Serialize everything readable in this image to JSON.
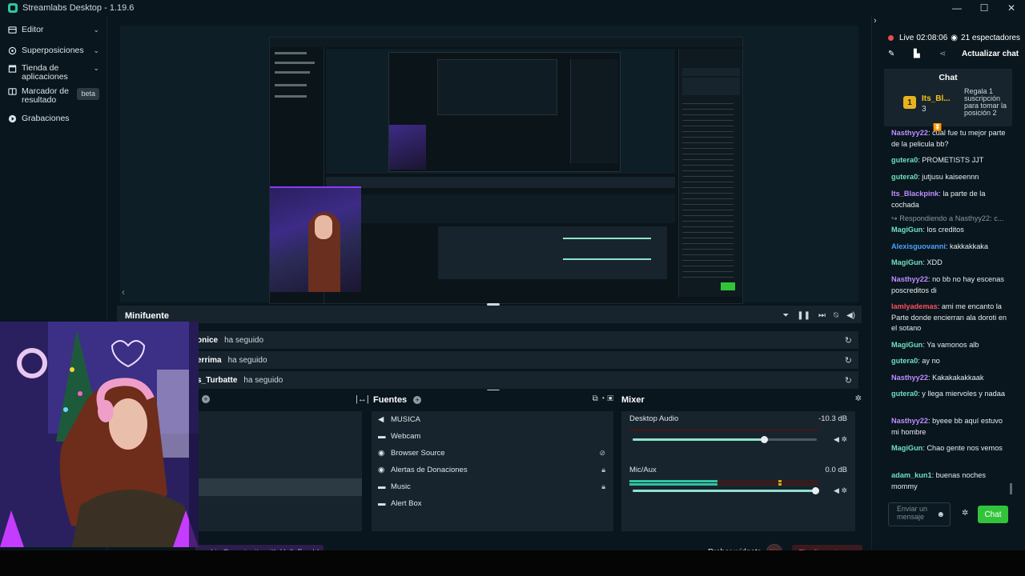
{
  "app": {
    "title": "Streamlabs Desktop - 1.19.6"
  },
  "window_controls": {
    "minimize": "—",
    "maximize": "☐",
    "close": "✕"
  },
  "nav": {
    "items": [
      {
        "label": "Editor",
        "icon": "pencil-icon"
      },
      {
        "label": "Superposiciones",
        "icon": "layers-icon"
      },
      {
        "label": "Tienda de aplicaciones",
        "icon": "store-icon"
      },
      {
        "label": "Marcador de resultado",
        "icon": "scoreboard-icon",
        "badge": "beta"
      },
      {
        "label": "Grabaciones",
        "icon": "play-icon"
      }
    ]
  },
  "minifuente": {
    "title": "Minifuente",
    "events": [
      {
        "name": "onice",
        "action": "ha seguido"
      },
      {
        "name": "errima",
        "action": "ha seguido"
      },
      {
        "name": "s_Turbatte",
        "action": "ha seguido"
      }
    ]
  },
  "sources": {
    "title": "Fuentes",
    "items": [
      {
        "label": "MUSICA",
        "icon": "volume-icon",
        "state": ""
      },
      {
        "label": "Webcam",
        "icon": "folder-icon",
        "state": ""
      },
      {
        "label": "Browser Source",
        "icon": "globe-icon",
        "state": "hidden-icon"
      },
      {
        "label": "Alertas de Donaciones",
        "icon": "globe-icon",
        "state": "lock-icon"
      },
      {
        "label": "Music",
        "icon": "folder-icon",
        "state": "lock-icon"
      },
      {
        "label": "Alert Box",
        "icon": "folder-icon",
        "state": ""
      }
    ]
  },
  "mixer": {
    "title": "Mixer",
    "channels": [
      {
        "label": "Desktop Audio",
        "db": "-10.3 dB",
        "level": 0.72
      },
      {
        "label": "Mic/Aux",
        "db": "0.0 dB",
        "level": 1.0
      }
    ]
  },
  "footer": {
    "sponsor": "orship Opportunity with HelloFresh!",
    "probar": "Probar widgets",
    "rec": "REC",
    "finalizar": "Finalizar stream"
  },
  "chat": {
    "live_label": "Live",
    "time": "02:08:06",
    "viewers": "21 espectadores",
    "update": "Actualizar chat",
    "header": "Chat",
    "goal": {
      "rank": "1",
      "user": "Its_Bl...",
      "count": "3",
      "text": "Regala 1 suscripción para tomar la posición 2"
    },
    "messages": [
      {
        "user": "Nasthyy22",
        "color": "#c08cff",
        "text": ": cual fue tu mejor parte de la pelicula bb?"
      },
      {
        "user": "gutera0",
        "color": "#6fe0c0",
        "text": ": PROMETISTS JJT"
      },
      {
        "user": "gutera0",
        "color": "#6fe0c0",
        "text": ": jutjusu kaiseennn"
      },
      {
        "user": "Its_Blackpink",
        "color": "#c08cff",
        "text": ": la parte de la cochada"
      },
      {
        "user": "",
        "color": "#8a979d",
        "text": "↪ Respondiendo a Nasthyy22: c..."
      },
      {
        "user": "MagiGun",
        "color": "#6fe0c0",
        "text": ": los creditos"
      },
      {
        "user": "Alexisguovanni",
        "color": "#4aa3ff",
        "text": ": kakkakkaka"
      },
      {
        "user": "MagiGun",
        "color": "#6fe0c0",
        "text": ": XDD"
      },
      {
        "user": "Nasthyy22",
        "color": "#c08cff",
        "text": ": no bb no hay escenas poscreditos di"
      },
      {
        "user": "lamlyademas",
        "color": "#ff4f5e",
        "text": ": ami me encanto la Parte donde encierran ala doroti en el sotano"
      },
      {
        "user": "MagiGun",
        "color": "#6fe0c0",
        "text": ": Ya vamonos alb"
      },
      {
        "user": "gutera0",
        "color": "#6fe0c0",
        "text": ": ay no"
      },
      {
        "user": "Nasthyy22",
        "color": "#c08cff",
        "text": ": Kakakakakkaak"
      },
      {
        "user": "gutera0",
        "color": "#6fe0c0",
        "text": ": y llega miervoles y nadaa"
      },
      {
        "user": "Nasthyy22",
        "color": "#c08cff",
        "text": ": byeee bb aquí estuvo mi hombre"
      },
      {
        "user": "MagiGun",
        "color": "#6fe0c0",
        "text": ": Chao gente nos vemos"
      },
      {
        "user": "adam_kun1",
        "color": "#6fe0c0",
        "text": ": buenas noches mommy"
      }
    ],
    "input_placeholder": "Enviar un mensaje",
    "send": "Chat"
  },
  "colors": {
    "accent": "#31c3a2",
    "live": "#f04a4a",
    "chat_button": "#31c43a"
  }
}
